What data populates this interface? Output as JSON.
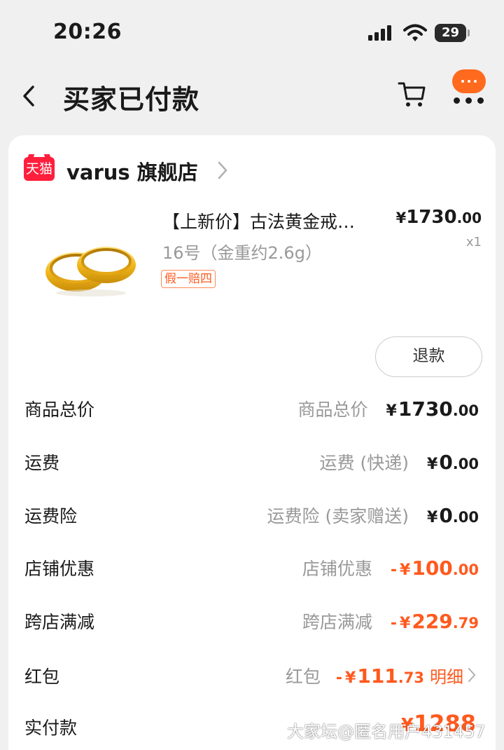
{
  "status_bar": {
    "time": "20:26",
    "battery": "29"
  },
  "nav": {
    "title": "买家已付款"
  },
  "shop": {
    "badge": "天猫",
    "name": "varus 旗舰店"
  },
  "product": {
    "title": "【上新价】古法黄金戒…",
    "spec": "16号（金重约2.6g）",
    "tag": "假一赔四",
    "price_yen": "¥",
    "price_int": "1730",
    "price_dec": ".00",
    "qty": "x1",
    "refund": "退款"
  },
  "rows": [
    {
      "label": "商品总价",
      "sub": "商品总价",
      "sign": "",
      "yen": "¥",
      "int": "1730",
      "dec": ".00"
    },
    {
      "label": "运费",
      "sub": "运费 (快递)",
      "sign": "",
      "yen": "¥",
      "int": "0",
      "dec": ".00"
    },
    {
      "label": "运费险",
      "sub": "运费险 (卖家赠送)",
      "sign": "",
      "yen": "¥",
      "int": "0",
      "dec": ".00"
    },
    {
      "label": "店铺优惠",
      "sub": "店铺优惠",
      "sign": "-",
      "yen": "¥",
      "int": "100",
      "dec": ".00"
    },
    {
      "label": "跨店满减",
      "sub": "跨店满减",
      "sign": "-",
      "yen": "¥",
      "int": "229",
      "dec": ".79"
    },
    {
      "label": "红包",
      "sub": "红包",
      "sign": "-",
      "yen": "¥",
      "int": "111",
      "dec": ".73",
      "link": "明细"
    }
  ],
  "final": {
    "label": "实付款",
    "yen": "¥",
    "int": "1288"
  },
  "watermark": "大家坛@匿名用户431457",
  "colors": {
    "accent": "#ff5a1f",
    "tmall": "#ff1f3d",
    "background": "#f0f0f0"
  }
}
